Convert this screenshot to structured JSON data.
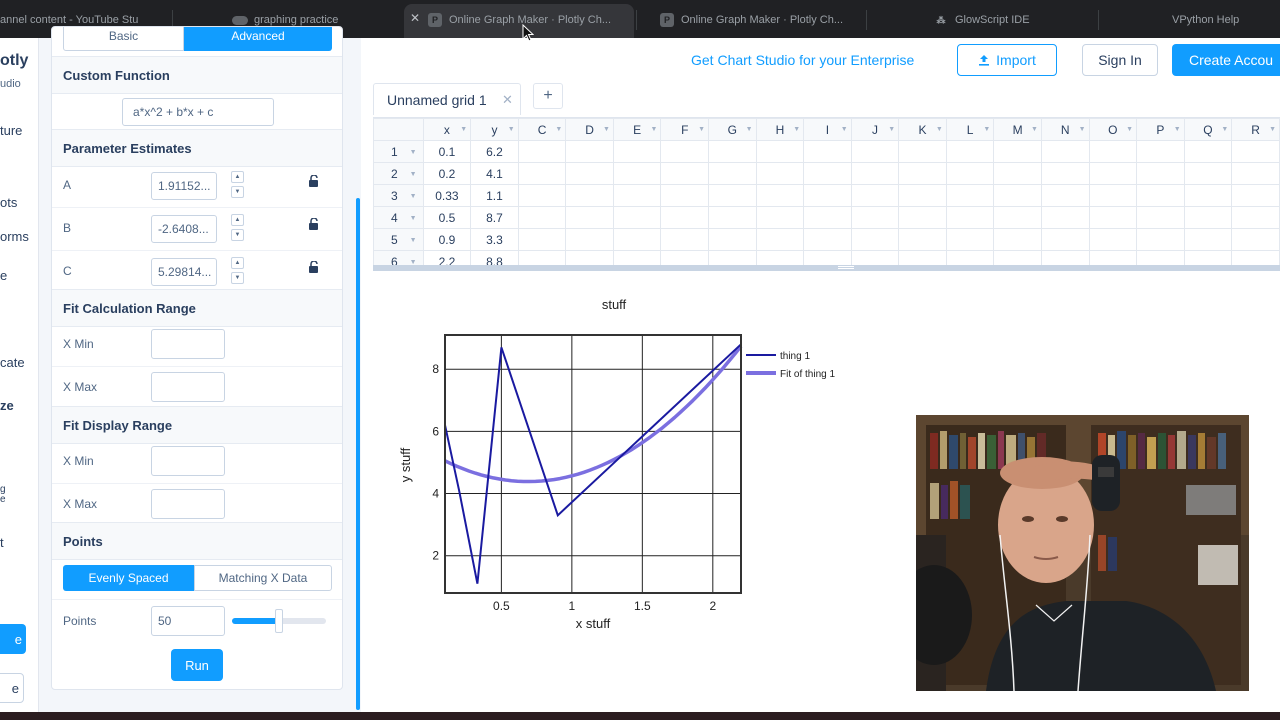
{
  "browser": {
    "tabs": [
      {
        "title": "annel content - YouTube Stu"
      },
      {
        "title": "graphing practice"
      },
      {
        "title": "Online Graph Maker · Plotly Ch..."
      },
      {
        "title": "Online Graph Maker · Plotly Ch..."
      },
      {
        "title": "GlowScript IDE"
      },
      {
        "title": "VPython Help"
      }
    ],
    "close_glyph": "✕"
  },
  "leftnav": {
    "brand": "otly",
    "brand_sub": "udio",
    "items": [
      "ture",
      "ots",
      "orms",
      "e",
      "cate",
      "ze",
      "g",
      "e",
      "t"
    ],
    "button_primary": "e",
    "button_secondary": "e"
  },
  "fit_panel": {
    "mode_tabs": [
      "Basic",
      "Advanced"
    ],
    "active_mode": "Advanced",
    "custom_function": {
      "heading": "Custom Function",
      "value": "a*x^2 + b*x + c"
    },
    "parameter_estimates": {
      "heading": "Parameter Estimates",
      "params": [
        {
          "name": "A",
          "value": "1.91152..."
        },
        {
          "name": "B",
          "value": "-2.6408..."
        },
        {
          "name": "C",
          "value": "5.29814..."
        }
      ]
    },
    "fit_calculation_range": {
      "heading": "Fit Calculation Range",
      "x_min_label": "X Min",
      "x_max_label": "X Max",
      "x_min": "",
      "x_max": ""
    },
    "fit_display_range": {
      "heading": "Fit Display Range",
      "x_min_label": "X Min",
      "x_max_label": "X Max",
      "x_min": "",
      "x_max": ""
    },
    "points": {
      "heading": "Points",
      "options": [
        "Evenly Spaced",
        "Matching X Data"
      ],
      "selected": "Evenly Spaced",
      "points_label": "Points",
      "points_value": "50",
      "slider_fraction": 0.5
    },
    "run_label": "Run"
  },
  "topbar": {
    "enterprise": "Get Chart Studio for your Enterprise",
    "import": "Import",
    "sign_in": "Sign In",
    "create_account": "Create Accou"
  },
  "grid": {
    "tab_title": "Unnamed grid 1",
    "tab_close": "✕",
    "add_tab": "+",
    "columns": [
      "x",
      "y",
      "C",
      "D",
      "E",
      "F",
      "G",
      "H",
      "I",
      "J",
      "K",
      "L",
      "M",
      "N",
      "O",
      "P",
      "Q",
      "R"
    ],
    "rows": [
      {
        "n": "1",
        "x": "0.1",
        "y": "6.2"
      },
      {
        "n": "2",
        "x": "0.2",
        "y": "4.1"
      },
      {
        "n": "3",
        "x": "0.33",
        "y": "1.1"
      },
      {
        "n": "4",
        "x": "0.5",
        "y": "8.7"
      },
      {
        "n": "5",
        "x": "0.9",
        "y": "3.3"
      },
      {
        "n": "6",
        "x": "2.2",
        "y": "8.8"
      }
    ]
  },
  "chart_data": {
    "type": "line",
    "title": "stuff",
    "xlabel": "x stuff",
    "ylabel": "y stuff",
    "xlim": [
      0.1,
      2.2
    ],
    "ylim": [
      0.8,
      9.1
    ],
    "xticks": [
      0.5,
      1,
      1.5,
      2
    ],
    "xtick_labels": [
      "0.5",
      "1",
      "1.5",
      "2"
    ],
    "yticks": [
      2,
      4,
      6,
      8
    ],
    "ytick_labels": [
      "2",
      "4",
      "6",
      "8"
    ],
    "grid": true,
    "legend_position": "top-right-outside",
    "series": [
      {
        "name": "thing 1",
        "color": "#1a1aa0",
        "x": [
          0.1,
          0.2,
          0.33,
          0.5,
          0.9,
          2.2
        ],
        "y": [
          6.2,
          4.1,
          1.1,
          8.7,
          3.3,
          8.8
        ]
      },
      {
        "name": "Fit of thing 1",
        "color": "#7b6fe0",
        "fit": {
          "a": 1.91152,
          "b": -2.6408,
          "c": 5.29814
        },
        "x_range": [
          0.1,
          2.2
        ],
        "points": 50
      }
    ]
  }
}
